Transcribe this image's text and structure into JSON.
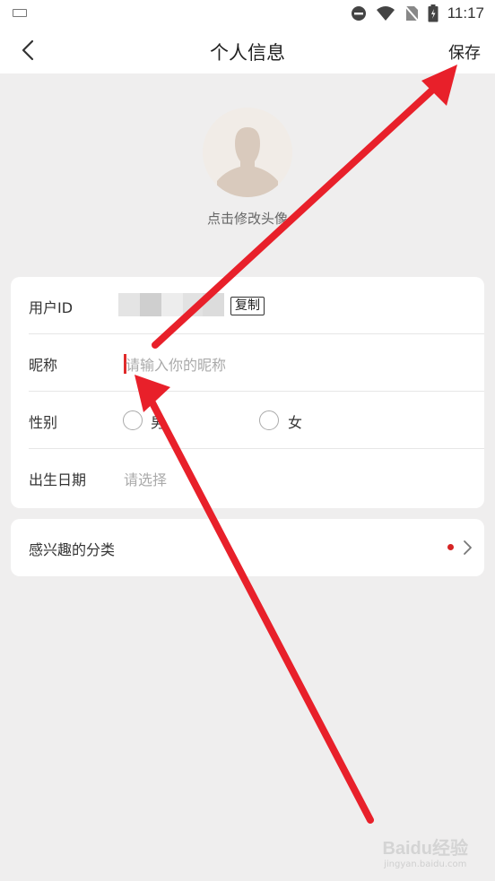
{
  "status_bar": {
    "time": "11:17"
  },
  "nav": {
    "title": "个人信息",
    "save_label": "保存"
  },
  "avatar": {
    "caption": "点击修改头像"
  },
  "form": {
    "user_id": {
      "label": "用户ID",
      "copy_label": "复制"
    },
    "nickname": {
      "label": "昵称",
      "placeholder": "请输入你的昵称"
    },
    "gender": {
      "label": "性别",
      "options": [
        "男",
        "女"
      ]
    },
    "birthday": {
      "label": "出生日期",
      "placeholder": "请选择"
    }
  },
  "interest": {
    "label": "感兴趣的分类"
  },
  "colors": {
    "accent": "#d62424",
    "annotation_arrow": "#e8202a",
    "background": "#efeeee"
  },
  "watermark": {
    "brand": "Baidu经验",
    "url": "jingyan.baidu.com"
  }
}
